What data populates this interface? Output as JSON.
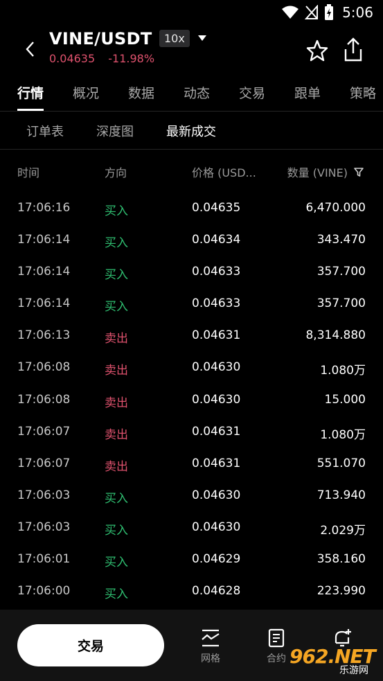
{
  "status_bar": {
    "time": "5:06",
    "icons": [
      "wifi-icon",
      "no-signal-icon",
      "battery-charging-icon"
    ]
  },
  "header": {
    "pair": "VINE/USDT",
    "leverage": "10x",
    "last_price": "0.04635",
    "change": "-11.98%",
    "icons": [
      "back-arrow-icon",
      "chevron-down-icon",
      "star-icon",
      "share-icon"
    ]
  },
  "tabs": [
    {
      "label": "行情",
      "active": true
    },
    {
      "label": "概况",
      "active": false
    },
    {
      "label": "数据",
      "active": false
    },
    {
      "label": "动态",
      "active": false
    },
    {
      "label": "交易",
      "active": false
    },
    {
      "label": "跟单",
      "active": false
    },
    {
      "label": "策略",
      "active": false
    }
  ],
  "subtabs": [
    {
      "label": "订单表",
      "active": false
    },
    {
      "label": "深度图",
      "active": false
    },
    {
      "label": "最新成交",
      "active": true
    }
  ],
  "columns": {
    "time": "时间",
    "side": "方向",
    "price": "价格 (USD...",
    "quantity": "数量 (VINE)"
  },
  "colors": {
    "buy": "#2fbf71",
    "sell": "#e0526e",
    "background": "#000000"
  },
  "trades": [
    {
      "time": "17:06:16",
      "side": "买入",
      "type": "buy",
      "price": "0.04635",
      "qty": "6,470.000"
    },
    {
      "time": "17:06:14",
      "side": "买入",
      "type": "buy",
      "price": "0.04634",
      "qty": "343.470"
    },
    {
      "time": "17:06:14",
      "side": "买入",
      "type": "buy",
      "price": "0.04633",
      "qty": "357.700"
    },
    {
      "time": "17:06:14",
      "side": "买入",
      "type": "buy",
      "price": "0.04633",
      "qty": "357.700"
    },
    {
      "time": "17:06:13",
      "side": "卖出",
      "type": "sell",
      "price": "0.04631",
      "qty": "8,314.880"
    },
    {
      "time": "17:06:08",
      "side": "卖出",
      "type": "sell",
      "price": "0.04630",
      "qty": "1.080万"
    },
    {
      "time": "17:06:08",
      "side": "卖出",
      "type": "sell",
      "price": "0.04630",
      "qty": "15.000"
    },
    {
      "time": "17:06:07",
      "side": "卖出",
      "type": "sell",
      "price": "0.04631",
      "qty": "1.080万"
    },
    {
      "time": "17:06:07",
      "side": "卖出",
      "type": "sell",
      "price": "0.04631",
      "qty": "551.070"
    },
    {
      "time": "17:06:03",
      "side": "买入",
      "type": "buy",
      "price": "0.04630",
      "qty": "713.940"
    },
    {
      "time": "17:06:03",
      "side": "买入",
      "type": "buy",
      "price": "0.04630",
      "qty": "2.029万"
    },
    {
      "time": "17:06:01",
      "side": "买入",
      "type": "buy",
      "price": "0.04629",
      "qty": "358.160"
    },
    {
      "time": "17:06:00",
      "side": "买入",
      "type": "buy",
      "price": "0.04628",
      "qty": "223.990"
    }
  ],
  "bottom_bar": {
    "trade_button": "交易",
    "nav": [
      {
        "label": "网格",
        "icon": "grid-chart-icon"
      },
      {
        "label": "合约",
        "icon": "contract-icon"
      },
      {
        "label": "",
        "icon": "bell-plus-icon"
      }
    ]
  },
  "watermark": {
    "main": "962.NET",
    "sub": "乐游网"
  }
}
